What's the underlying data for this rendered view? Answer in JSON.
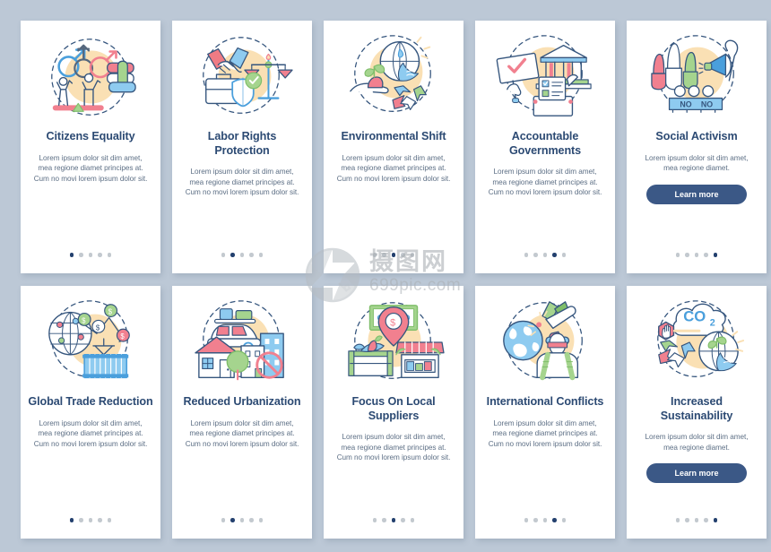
{
  "background_color": "#bcc8d6",
  "card_color": "#ffffff",
  "accent_colors": {
    "title": "#2c4a73",
    "body": "#5d6f85",
    "button": "#3b5886",
    "dot_active": "#23406e",
    "dot_inactive": "#c3c9cf",
    "illustration_blob": "#fae0b4"
  },
  "watermark": {
    "logo": "aperture-camera-logo",
    "title": "摄图网",
    "subtitle": "699pic.com"
  },
  "cards": [
    {
      "id": "citizens-equality",
      "illustration": "gender-equality-icon",
      "title": "Citizens Equality",
      "body": "Lorem ipsum dolor sit dim amet, mea regione diamet principes at. Cum no movi lorem ipsum dolor sit.",
      "button": null,
      "dots": {
        "count": 5,
        "active": 0
      }
    },
    {
      "id": "labor-rights-protection",
      "illustration": "handshake-scales-icon",
      "title": "Labor Rights Protection",
      "body": "Lorem ipsum dolor sit dim amet, mea regione diamet principes at. Cum no movi lorem ipsum dolor sit.",
      "button": null,
      "dots": {
        "count": 5,
        "active": 1
      }
    },
    {
      "id": "environmental-shift",
      "illustration": "globe-recycle-plant-icon",
      "title": "Environmental Shift",
      "body": "Lorem ipsum dolor sit dim amet, mea regione diamet principes at. Cum no movi lorem ipsum dolor sit.",
      "button": null,
      "dots": {
        "count": 5,
        "active": 2
      }
    },
    {
      "id": "accountable-governments",
      "illustration": "government-ballot-icon",
      "title": "Accountable Governments",
      "body": "Lorem ipsum dolor sit dim amet, mea regione diamet principes at. Cum no movi lorem ipsum dolor sit.",
      "button": null,
      "dots": {
        "count": 5,
        "active": 3
      }
    },
    {
      "id": "social-activism",
      "illustration": "protest-megaphone-icon",
      "title": "Social Activism",
      "body": "Lorem ipsum dolor sit dim amet, mea regione diamet.",
      "button": "Learn more",
      "dots": {
        "count": 5,
        "active": 4
      }
    },
    {
      "id": "global-trade-reduction",
      "illustration": "globe-container-chart-icon",
      "title": "Global Trade Reduction",
      "body": "Lorem ipsum dolor sit dim amet, mea regione diamet principes at. Cum no movi lorem ipsum dolor sit.",
      "button": null,
      "dots": {
        "count": 5,
        "active": 0
      }
    },
    {
      "id": "reduced-urbanization",
      "illustration": "house-city-car-icon",
      "title": "Reduced Urbanization",
      "body": "Lorem ipsum dolor sit dim amet, mea regione diamet principes at. Cum no movi lorem ipsum dolor sit.",
      "button": null,
      "dots": {
        "count": 5,
        "active": 1
      }
    },
    {
      "id": "focus-on-local-suppliers",
      "illustration": "local-market-produce-icon",
      "title": "Focus On Local Suppliers",
      "body": "Lorem ipsum dolor sit dim amet, mea regione diamet principes at. Cum no movi lorem ipsum dolor sit.",
      "button": null,
      "dots": {
        "count": 5,
        "active": 2
      }
    },
    {
      "id": "international-conflicts",
      "illustration": "soldier-missile-globe-icon",
      "title": "International Conflicts",
      "body": "Lorem ipsum dolor sit dim amet, mea regione diamet principes at. Cum no movi lorem ipsum dolor sit.",
      "button": null,
      "dots": {
        "count": 5,
        "active": 3
      }
    },
    {
      "id": "increased-sustainability",
      "illustration": "co2-recycle-globe-icon",
      "title": "Increased Sustainability",
      "body": "Lorem ipsum dolor sit dim amet, mea regione diamet.",
      "button": "Learn more",
      "dots": {
        "count": 5,
        "active": 4
      }
    }
  ]
}
